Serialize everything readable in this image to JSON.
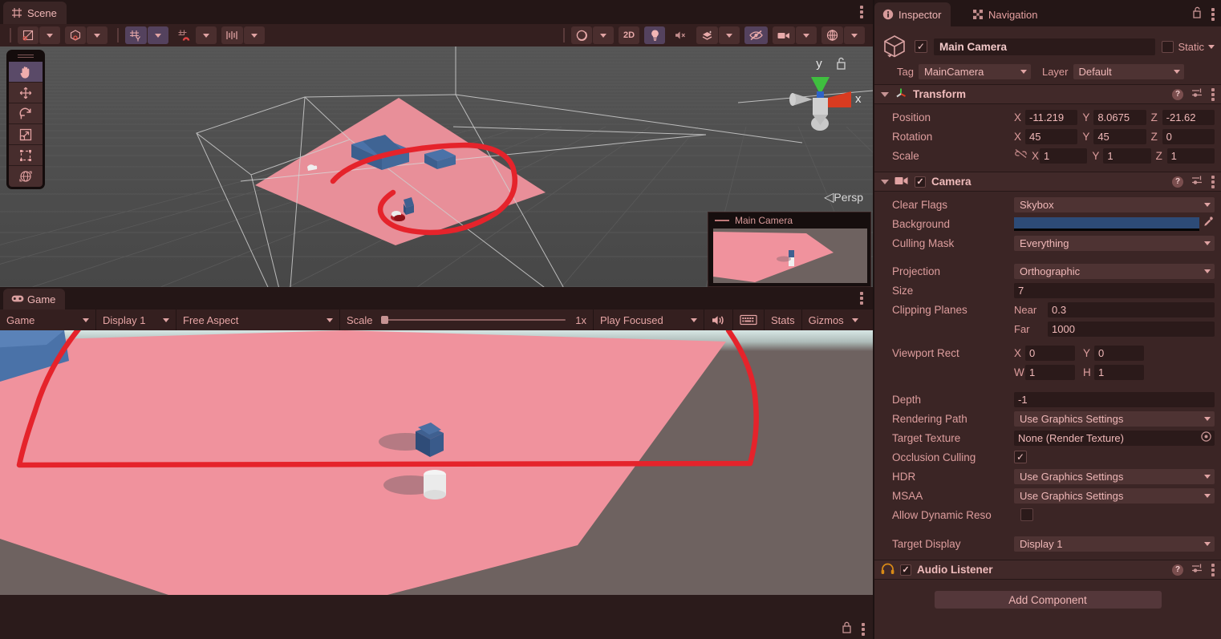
{
  "scene_panel": {
    "tab": {
      "label": "Scene",
      "icon": "grid-icon"
    },
    "toolbar": {
      "left_tools": [
        {
          "name": "pivot-rotation-toggle",
          "icon": "pivot-icon",
          "has_caret": true,
          "state": "off"
        },
        {
          "name": "handle-position-toggle",
          "icon": "cube-pivot-icon",
          "has_caret": true,
          "state": "off"
        },
        {
          "name": "grid-axis-y",
          "icon": "grid-y-icon",
          "has_caret": true,
          "state": "on"
        },
        {
          "name": "grid-snapping",
          "icon": "magnet-icon",
          "has_caret": true,
          "state": "off"
        },
        {
          "name": "increment-snap",
          "icon": "ruler-icon",
          "has_caret": true,
          "state": "off"
        }
      ],
      "right_tools": [
        {
          "name": "shading-mode",
          "icon": "sphere-icon",
          "has_caret": true,
          "state": "off"
        },
        {
          "name": "toggle-2d",
          "label": "2D",
          "state": "off"
        },
        {
          "name": "scene-lighting",
          "icon": "bulb-icon",
          "state": "on"
        },
        {
          "name": "scene-audio",
          "icon": "speaker-muted-icon",
          "state": "off"
        },
        {
          "name": "scene-fx",
          "icon": "fx-icon",
          "has_caret": true,
          "state": "off"
        },
        {
          "name": "scene-visibility",
          "icon": "eye-slash-icon",
          "state": "on"
        },
        {
          "name": "scene-camera",
          "icon": "camera-icon",
          "has_caret": true,
          "state": "off"
        },
        {
          "name": "gizmos-toggle",
          "icon": "gizmo-globe-icon",
          "has_caret": true,
          "state": "off"
        }
      ]
    },
    "tool_palette": [
      {
        "name": "hand-tool",
        "icon": "hand-icon",
        "selected": true
      },
      {
        "name": "move-tool",
        "icon": "move-icon",
        "selected": false
      },
      {
        "name": "rotate-tool",
        "icon": "rotate-icon",
        "selected": false
      },
      {
        "name": "scale-tool",
        "icon": "scale-icon",
        "selected": false
      },
      {
        "name": "rect-tool",
        "icon": "rect-icon",
        "selected": false
      },
      {
        "name": "transform-tool",
        "icon": "transform-icon",
        "selected": false
      }
    ],
    "gizmo": {
      "y_label": "y",
      "x_label": "x",
      "projection_label": "Persp"
    },
    "camera_preview": {
      "title": "Main Camera"
    }
  },
  "game_panel": {
    "tab": {
      "label": "Game",
      "icon": "gamepad-icon"
    },
    "toolbar": {
      "view_selector": "Game",
      "display": "Display 1",
      "aspect": "Free Aspect",
      "scale_label": "Scale",
      "scale_value": "1x",
      "play_mode": "Play Focused",
      "mute_icon": "speaker-icon",
      "keyboard_icon": "keyboard-icon",
      "stats_label": "Stats",
      "gizmos_label": "Gizmos"
    },
    "status_bar": {
      "lock_icon": "lock-icon",
      "menu_icon": "kebab-icon"
    }
  },
  "inspector": {
    "tabs": [
      {
        "label": "Inspector",
        "icon": "info-icon",
        "active": true
      },
      {
        "label": "Navigation",
        "icon": "navigation-icon",
        "active": false
      }
    ],
    "header_icons": {
      "lock": "lock-open-icon",
      "menu": "kebab-icon"
    },
    "object": {
      "icon": "cube-icon",
      "enabled": true,
      "name": "Main Camera",
      "static_label": "Static",
      "static_checked": false,
      "tag_label": "Tag",
      "tag_value": "MainCamera",
      "layer_label": "Layer",
      "layer_value": "Default"
    },
    "components": [
      {
        "name": "Transform",
        "icon": "transform-axes-icon",
        "expanded": true,
        "has_checkbox": false,
        "rows": [
          {
            "label": "Position",
            "type": "vec3",
            "locked_icon": null,
            "fields": [
              {
                "axis": "X",
                "value": "-11.219"
              },
              {
                "axis": "Y",
                "value": "8.0675"
              },
              {
                "axis": "Z",
                "value": "-21.62"
              }
            ]
          },
          {
            "label": "Rotation",
            "type": "vec3",
            "locked_icon": null,
            "fields": [
              {
                "axis": "X",
                "value": "45"
              },
              {
                "axis": "Y",
                "value": "45"
              },
              {
                "axis": "Z",
                "value": "0"
              }
            ]
          },
          {
            "label": "Scale",
            "type": "vec3",
            "locked_icon": "link-broken-icon",
            "fields": [
              {
                "axis": "X",
                "value": "1"
              },
              {
                "axis": "Y",
                "value": "1"
              },
              {
                "axis": "Z",
                "value": "1"
              }
            ]
          }
        ]
      },
      {
        "name": "Camera",
        "icon": "camera-icon",
        "expanded": true,
        "has_checkbox": true,
        "checked": true,
        "rows": [
          {
            "label": "Clear Flags",
            "type": "dropdown",
            "value": "Skybox"
          },
          {
            "label": "Background",
            "type": "color",
            "value": "#2d4b77",
            "picker_icon": "eyedropper-icon"
          },
          {
            "label": "Culling Mask",
            "type": "dropdown",
            "value": "Everything"
          },
          {
            "label": "",
            "type": "spacer"
          },
          {
            "label": "Projection",
            "type": "dropdown",
            "value": "Orthographic"
          },
          {
            "label": "Size",
            "type": "text",
            "value": "7"
          },
          {
            "label": "Clipping Planes",
            "type": "pair",
            "sub_label": "Near",
            "value": "0.3"
          },
          {
            "label": "",
            "type": "pair",
            "sub_label": "Far",
            "value": "1000"
          },
          {
            "label": "Viewport Rect",
            "type": "vec2",
            "fields": [
              {
                "axis": "X",
                "value": "0"
              },
              {
                "axis": "Y",
                "value": "0"
              }
            ]
          },
          {
            "label": "",
            "type": "vec2",
            "fields": [
              {
                "axis": "W",
                "value": "1"
              },
              {
                "axis": "H",
                "value": "1"
              }
            ]
          },
          {
            "label": "",
            "type": "spacer"
          },
          {
            "label": "Depth",
            "type": "text",
            "value": "-1"
          },
          {
            "label": "Rendering Path",
            "type": "dropdown",
            "value": "Use Graphics Settings"
          },
          {
            "label": "Target Texture",
            "type": "object",
            "value": "None (Render Texture)",
            "picker_icon": "object-picker-icon"
          },
          {
            "label": "Occlusion Culling",
            "type": "checkbox",
            "checked": true
          },
          {
            "label": "HDR",
            "type": "dropdown",
            "value": "Use Graphics Settings"
          },
          {
            "label": "MSAA",
            "type": "dropdown",
            "value": "Use Graphics Settings"
          },
          {
            "label": "Allow Dynamic Reso",
            "type": "checkbox",
            "checked": false
          },
          {
            "label": "",
            "type": "spacer"
          },
          {
            "label": "Target Display",
            "type": "dropdown",
            "value": "Display 1"
          }
        ]
      },
      {
        "name": "Audio Listener",
        "icon": "headphones-icon",
        "expanded": false,
        "has_checkbox": true,
        "checked": true,
        "rows": []
      }
    ],
    "add_component_label": "Add Component"
  },
  "annotation": {
    "color": "#e5232b",
    "description": "hand-drawn red loop over scene floor and red path over game view"
  },
  "colors": {
    "accent_red": "#e5232b",
    "panel_bg": "#3b2525",
    "toolbar_bg": "#341f1f",
    "field_bg": "#2b1a1a",
    "text": "#dd9d9d",
    "camera_background": "#2d4b77",
    "floor_pink": "#f0929d",
    "ground_gray": "#6e6260"
  }
}
